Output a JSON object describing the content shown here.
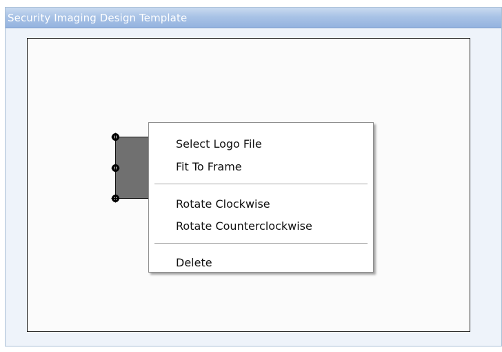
{
  "panel": {
    "title": "Security Imaging Design Template"
  },
  "canvas": {
    "logo_placeholder": {
      "fill_color": "#707070",
      "handles": [
        "top-left",
        "top-center",
        "top-right",
        "middle-left",
        "bottom-left"
      ]
    }
  },
  "context_menu": {
    "items": [
      {
        "label": "Select Logo File"
      },
      {
        "label": "Fit To Frame"
      },
      {
        "label": "Rotate Clockwise"
      },
      {
        "label": "Rotate Counterclockwise"
      },
      {
        "label": "Delete"
      }
    ]
  },
  "colors": {
    "header_gradient_top": "#c9daf0",
    "header_gradient_bottom": "#94b3df",
    "panel_background": "#eef3fa",
    "canvas_background": "#fbfbfb",
    "logo_fill": "#707070"
  }
}
